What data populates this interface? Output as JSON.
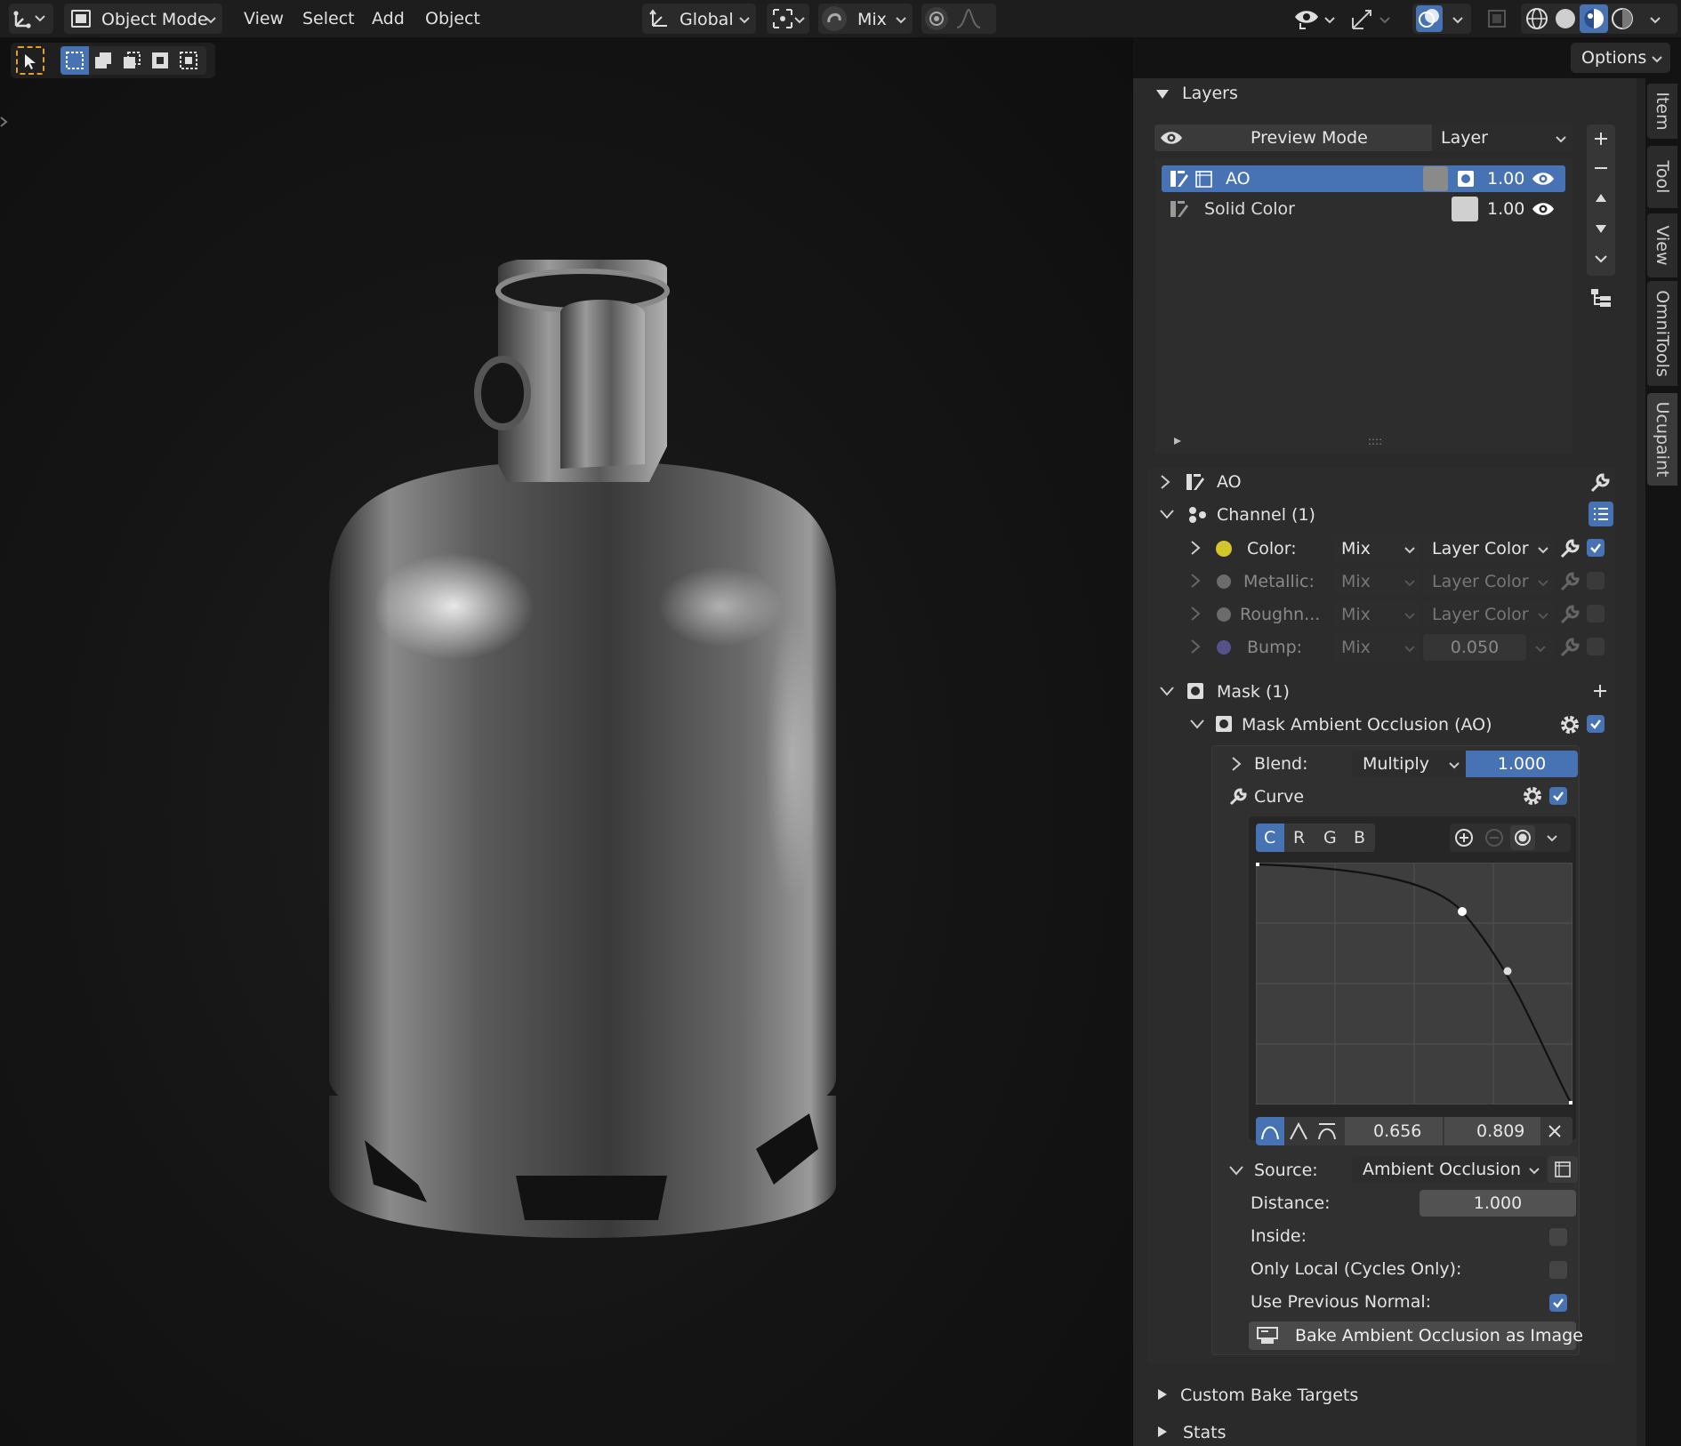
{
  "header": {
    "mode_label": "Object Mode",
    "menus": [
      "View",
      "Select",
      "Add",
      "Object"
    ],
    "transform_orientation": "Global",
    "snap_mode": "Mix",
    "options_label": "Options"
  },
  "sidebar_tabs": [
    "Item",
    "Tool",
    "View",
    "OmniTools",
    "Ucupaint"
  ],
  "layers_panel": {
    "title": "Layers",
    "preview_mode_label": "Preview Mode",
    "preview_dropdown": "Layer",
    "list": [
      {
        "name": "AO",
        "opacity": "1.00",
        "selected": true
      },
      {
        "name": "Solid Color",
        "opacity": "1.00",
        "selected": false
      }
    ],
    "list_grip": "::::"
  },
  "ao_section": {
    "title": "AO",
    "channel_header": "Channel (1)",
    "channels": [
      {
        "label": "Color:",
        "blend": "Mix",
        "source": "Layer Color",
        "enabled": true,
        "dot_color": "#d4c52a"
      },
      {
        "label": "Metallic:",
        "blend": "Mix",
        "source": "Layer Color",
        "enabled": false,
        "dot_color": "#6c6c6c"
      },
      {
        "label": "Roughn...",
        "blend": "Mix",
        "source": "Layer Color",
        "enabled": false,
        "dot_color": "#6c6c6c"
      },
      {
        "label": "Bump:",
        "blend": "Mix",
        "source": "0.050",
        "enabled": false,
        "dot_color": "#56518a"
      }
    ],
    "mask_header": "Mask (1)",
    "mask_name": "Mask Ambient Occlusion (AO)",
    "blend_label": "Blend:",
    "blend_mode": "Multiply",
    "blend_value": "1.000",
    "curve_label": "Curve",
    "curve_channels": [
      "C",
      "R",
      "G",
      "B"
    ],
    "curve_point_x": "0.656",
    "curve_point_y": "0.809",
    "source_label": "Source:",
    "source_value": "Ambient Occlusion",
    "distance_label": "Distance:",
    "distance_value": "1.000",
    "inside_label": "Inside:",
    "inside_checked": false,
    "only_local_label": "Only Local (Cycles Only):",
    "only_local_checked": false,
    "use_prev_normal_label": "Use Previous Normal:",
    "use_prev_normal_checked": true,
    "bake_button": "Bake Ambient Occlusion as Image"
  },
  "bottom_sections": [
    "Custom Bake Targets",
    "Stats"
  ],
  "colors": {
    "accent_blue": "#4772b3",
    "panel_bg": "#2a2a2a",
    "header_bg": "#1d1d1d"
  }
}
